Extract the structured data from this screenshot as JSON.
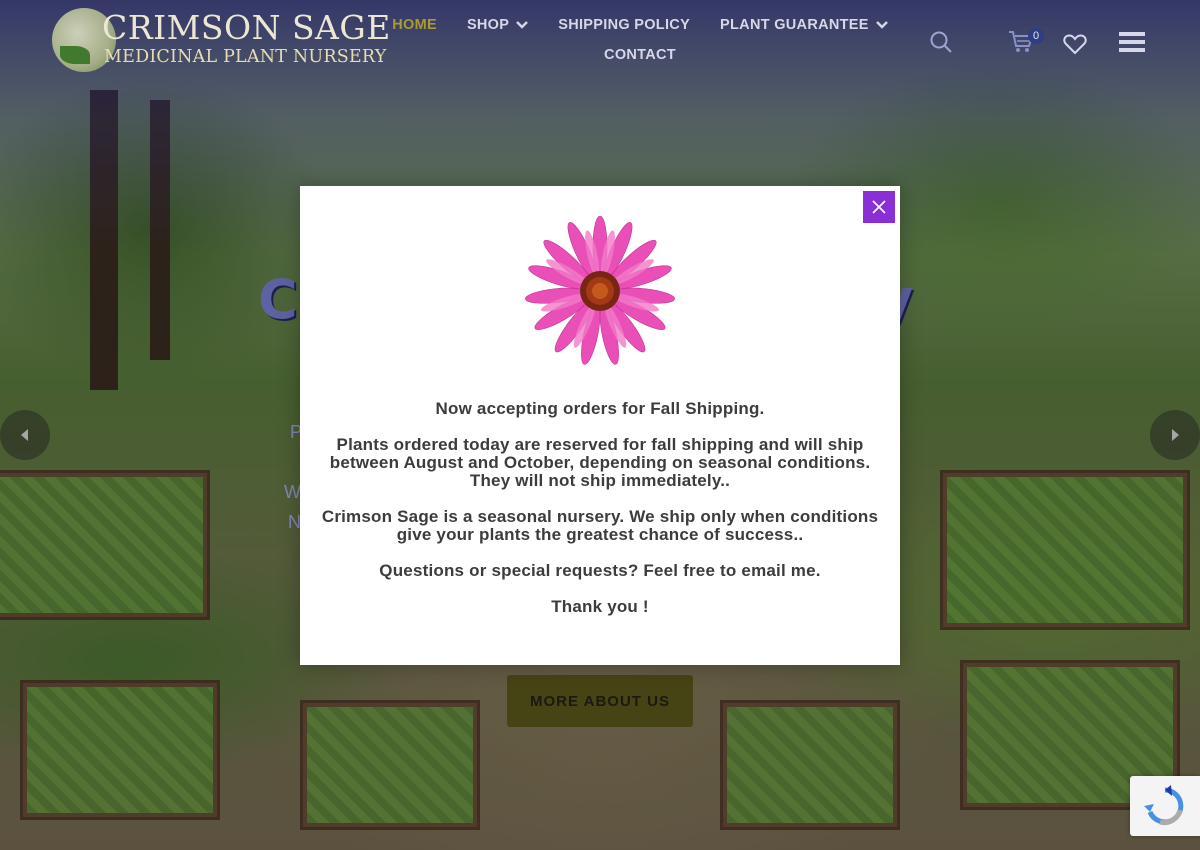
{
  "header": {
    "logo": {
      "title": "CRIMSON SAGE",
      "subtitle": "MEDICINAL PLANT NURSERY"
    },
    "nav": [
      {
        "label": "HOME",
        "active": true,
        "has_dropdown": false
      },
      {
        "label": "SHOP",
        "active": false,
        "has_dropdown": true
      },
      {
        "label": "SHIPPING POLICY",
        "active": false,
        "has_dropdown": false
      },
      {
        "label": "PLANT GUARANTEE",
        "active": false,
        "has_dropdown": true
      },
      {
        "label": "CONTACT",
        "active": false,
        "has_dropdown": false
      }
    ],
    "cart_count": "0",
    "icons": [
      "search-icon",
      "cart-icon",
      "heart-icon",
      "hamburger-menu-icon"
    ]
  },
  "hero": {
    "button_label": "MORE ABOUT US"
  },
  "modal": {
    "image": "echinacea-flower",
    "paragraphs": [
      "Now accepting orders for Fall Shipping.",
      "Plants ordered today are reserved for fall shipping and will ship between August and October, depending on seasonal conditions. They will not ship immediately..",
      "Crimson Sage is a seasonal nursery. We ship only when conditions give your plants the greatest chance of success..",
      "Questions or special requests? Feel free to email me.",
      "Thank you !"
    ]
  },
  "colors": {
    "header_overlay": "#2a2a82",
    "nav_active": "#a99a2e",
    "nav_text": "#d7d7e8",
    "close_button": "#8a2fd6",
    "modal_text": "#3c3c3c",
    "button_bg": "#5e5a1d"
  }
}
